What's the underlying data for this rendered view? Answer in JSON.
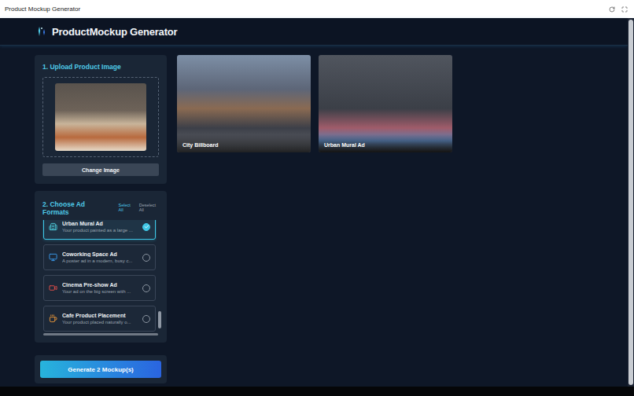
{
  "window": {
    "title": "Product Mockup Generator"
  },
  "header": {
    "logo_bold": "Product",
    "logo_rest": "Mockup Generator"
  },
  "upload": {
    "title": "1. Upload Product Image",
    "button": "Change Image"
  },
  "formats": {
    "title": "2. Choose Ad Formats",
    "select_all": "Select All",
    "deselect_all": "Deselect All",
    "items": [
      {
        "title": "Urban Mural Ad",
        "description": "Your product painted as a large ...",
        "selected": true,
        "kind": "mural",
        "color": "#4fd1e0"
      },
      {
        "title": "Coworking Space Ad",
        "description": "A poster ad in a modern, busy c...",
        "selected": false,
        "kind": "coworking",
        "color": "#3b9cf0"
      },
      {
        "title": "Cinema Pre-show Ad",
        "description": "Your ad on the big screen with ...",
        "selected": false,
        "kind": "cinema",
        "color": "#e8504a"
      },
      {
        "title": "Cafe Product Placement",
        "description": "Your product placed naturally o...",
        "selected": false,
        "kind": "cafe",
        "color": "#f09a3a"
      }
    ]
  },
  "generate": {
    "label": "Generate 2 Mockup(s)"
  },
  "results": [
    {
      "label": "City Billboard",
      "kind": "billboard"
    },
    {
      "label": "Urban Mural Ad",
      "kind": "mural"
    }
  ]
}
